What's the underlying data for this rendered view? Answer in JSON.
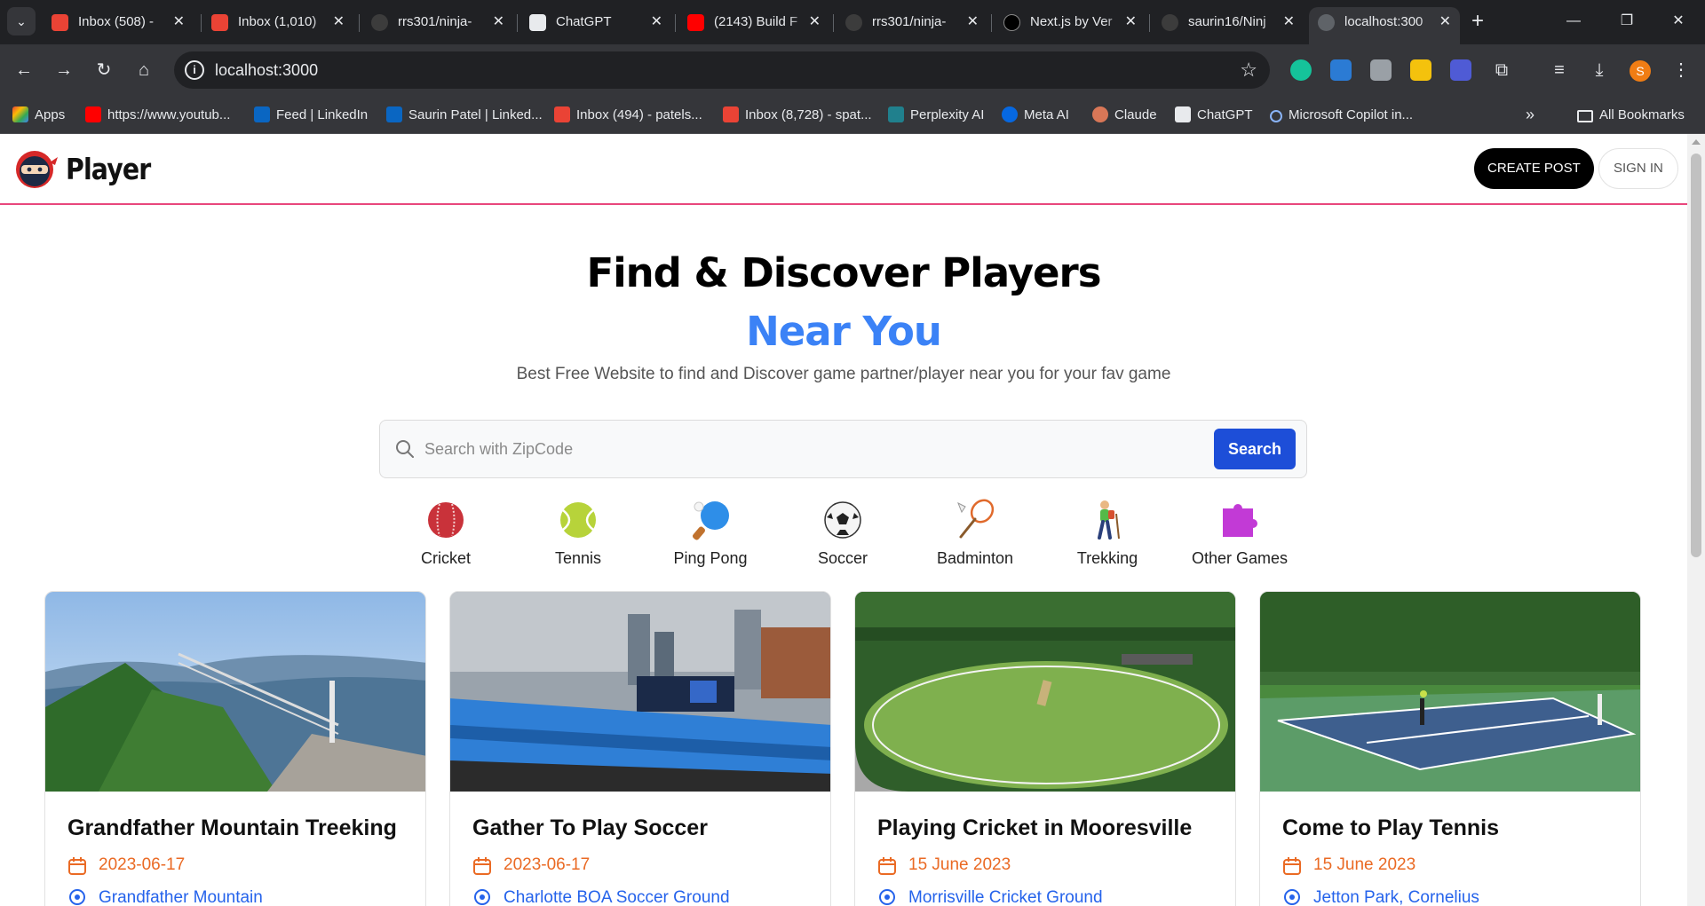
{
  "browser": {
    "tabs": [
      {
        "title": "Inbox (508) -",
        "active": false
      },
      {
        "title": "Inbox (1,010)",
        "active": false
      },
      {
        "title": "rrs301/ninja-",
        "active": false
      },
      {
        "title": "ChatGPT",
        "active": false
      },
      {
        "title": "(2143) Build F",
        "active": false
      },
      {
        "title": "rrs301/ninja-",
        "active": false
      },
      {
        "title": "Next.js by Ver",
        "active": false
      },
      {
        "title": "saurin16/Ninj",
        "active": false
      },
      {
        "title": "localhost:300",
        "active": true
      }
    ],
    "url": "localhost:3000",
    "profile_initial": "S",
    "bookmarks": {
      "apps": "Apps",
      "items": [
        "https://www.youtub...",
        "Feed | LinkedIn",
        "Saurin Patel | Linked...",
        "Inbox (494) - patels...",
        "Inbox (8,728) - spat...",
        "Perplexity AI",
        "Meta AI",
        "Claude",
        "ChatGPT",
        "Microsoft Copilot in..."
      ],
      "all": "All Bookmarks"
    }
  },
  "site": {
    "brand": "Player",
    "create_post": "CREATE POST",
    "sign_in": "SIGN IN"
  },
  "hero": {
    "title": "Find & Discover Players",
    "accent": "Near You",
    "subtitle": "Best Free Website to find and Discover game partner/player near you for your fav game"
  },
  "search": {
    "placeholder": "Search with ZipCode",
    "button": "Search"
  },
  "categories": [
    {
      "label": "Cricket",
      "icon": "cricket-ball-icon"
    },
    {
      "label": "Tennis",
      "icon": "tennis-ball-icon"
    },
    {
      "label": "Ping Pong",
      "icon": "ping-pong-icon"
    },
    {
      "label": "Soccer",
      "icon": "soccer-ball-icon"
    },
    {
      "label": "Badminton",
      "icon": "badminton-icon"
    },
    {
      "label": "Trekking",
      "icon": "trekking-icon"
    },
    {
      "label": "Other Games",
      "icon": "puzzle-icon"
    }
  ],
  "posts": [
    {
      "title": "Grandfather Mountain Treeking",
      "date": "2023-06-17",
      "location": "Grandfather Mountain"
    },
    {
      "title": "Gather To Play Soccer",
      "date": "2023-06-17",
      "location": "Charlotte BOA Soccer Ground"
    },
    {
      "title": "Playing Cricket in Mooresville",
      "date": "15 June 2023",
      "location": "Morrisville Cricket Ground"
    },
    {
      "title": "Come to Play Tennis",
      "date": "15 June 2023",
      "location": "Jetton Park, Cornelius"
    }
  ],
  "colors": {
    "accent_blue": "#3b82f6",
    "search_button": "#1d4ed8",
    "header_rule": "#e8477d",
    "date_orange": "#ea6a24",
    "location_blue": "#2563eb"
  }
}
